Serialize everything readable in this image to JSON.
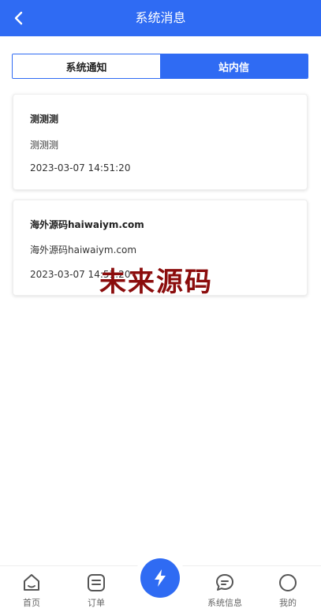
{
  "header": {
    "title": "系统消息",
    "back_icon": "chevron-left-icon"
  },
  "tabs": [
    {
      "label": "系统通知",
      "active": false
    },
    {
      "label": "站内信",
      "active": true
    }
  ],
  "messages": [
    {
      "title": "测测测",
      "body": "测测测",
      "time": "2023-03-07 14:51:20"
    },
    {
      "title": "海外源码haiwaiym.com",
      "body": "海外源码haiwaiym.com",
      "time": "2023-03-07 14:51:20"
    }
  ],
  "watermark": "未来源码",
  "tabbar": {
    "items": [
      {
        "label": "首页",
        "icon": "home-icon"
      },
      {
        "label": "订单",
        "icon": "order-icon"
      },
      {
        "label": "",
        "icon": "lightning-icon"
      },
      {
        "label": "系统信息",
        "icon": "chat-icon"
      },
      {
        "label": "我的",
        "icon": "profile-icon"
      }
    ]
  },
  "colors": {
    "primary": "#2f6bf3",
    "watermark": "#8b0c0c"
  }
}
